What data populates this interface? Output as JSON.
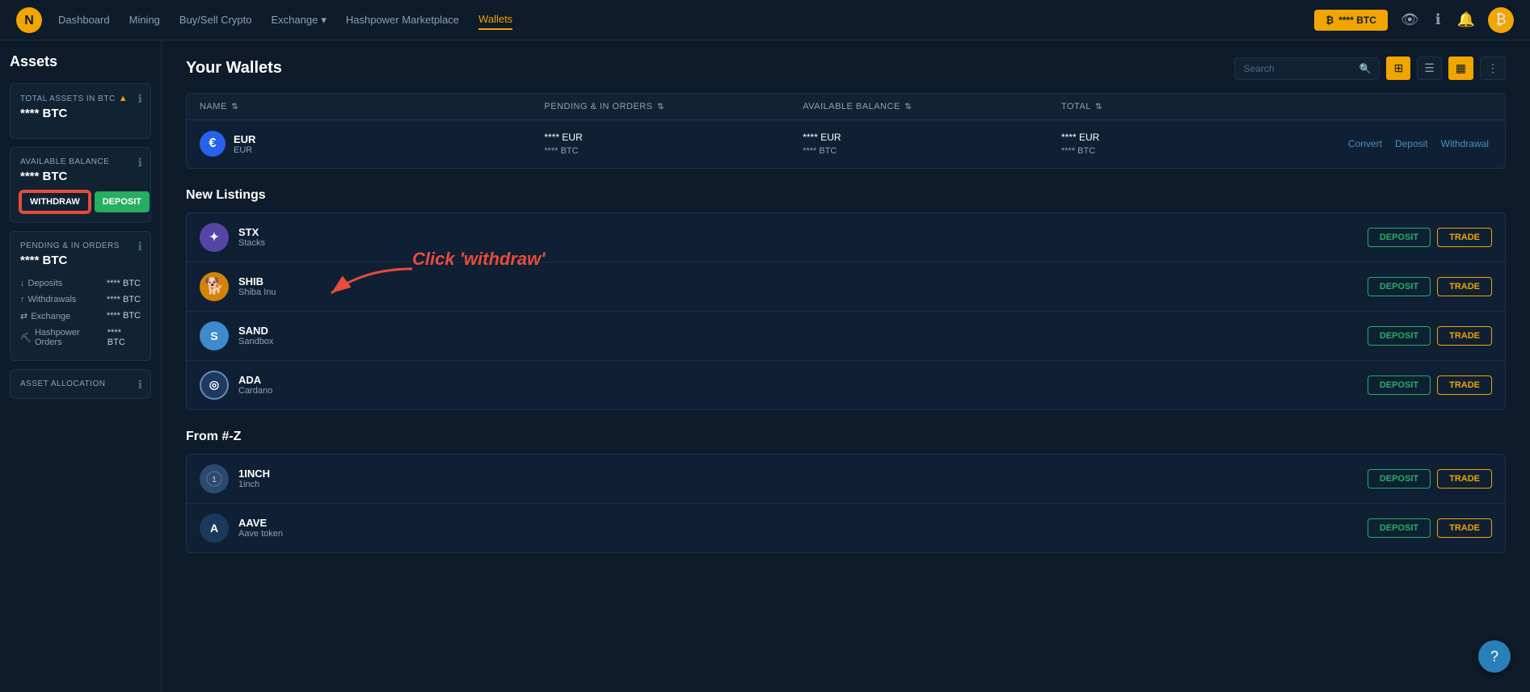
{
  "app": {
    "logo_symbol": "🟡",
    "nav_links": [
      {
        "label": "Dashboard",
        "active": false
      },
      {
        "label": "Mining",
        "active": false
      },
      {
        "label": "Buy/Sell Crypto",
        "active": false
      },
      {
        "label": "Exchange",
        "active": false,
        "has_dropdown": true
      },
      {
        "label": "Hashpower Marketplace",
        "active": false
      },
      {
        "label": "Wallets",
        "active": true
      }
    ],
    "btc_balance_btn": "**** BTC",
    "nav_icons": [
      "eye-slash",
      "info-circle",
      "bell",
      "bitcoin"
    ]
  },
  "sidebar": {
    "title": "Assets",
    "total_assets": {
      "label": "TOTAL ASSETS IN BTC",
      "value": "**** BTC"
    },
    "available_balance": {
      "label": "AVAILABLE BALANCE",
      "value": "**** BTC",
      "withdraw_label": "WITHDRAW",
      "deposit_label": "DEPOSIT"
    },
    "pending_orders": {
      "label": "PENDING & IN ORDERS",
      "value": "**** BTC",
      "rows": [
        {
          "icon": "↓",
          "label": "Deposits",
          "value": "**** BTC"
        },
        {
          "icon": "↑",
          "label": "Withdrawals",
          "value": "**** BTC"
        },
        {
          "icon": "⇄",
          "label": "Exchange",
          "value": "**** BTC"
        },
        {
          "icon": "⛏",
          "label": "Hashpower Orders",
          "value": "**** BTC"
        }
      ]
    },
    "asset_allocation": {
      "label": "ASSET ALLOCATION"
    }
  },
  "wallets": {
    "title": "Your Wallets",
    "search_placeholder": "Search",
    "table_headers": [
      {
        "label": "NAME",
        "sortable": true
      },
      {
        "label": "PENDING & IN ORDERS",
        "sortable": true
      },
      {
        "label": "AVAILABLE BALANCE",
        "sortable": true
      },
      {
        "label": "TOTAL",
        "sortable": true
      },
      {
        "label": ""
      }
    ],
    "rows": [
      {
        "icon": "€",
        "icon_bg": "#2563eb",
        "name": "EUR",
        "subtitle": "EUR",
        "pending": "**** EUR",
        "pending_sub": "**** BTC",
        "available": "**** EUR",
        "available_sub": "**** BTC",
        "total": "**** EUR",
        "total_sub": "**** BTC",
        "actions": [
          "Convert",
          "Deposit",
          "Withdrawal"
        ]
      }
    ]
  },
  "new_listings": {
    "title": "New Listings",
    "items": [
      {
        "icon": "✦",
        "icon_bg": "#5546a5",
        "name": "STX",
        "subtitle": "Stacks"
      },
      {
        "icon": "🐕",
        "icon_bg": "#d4830a",
        "name": "SHIB",
        "subtitle": "Shiba Inu"
      },
      {
        "icon": "S",
        "icon_bg": "#3d8bcd",
        "name": "SAND",
        "subtitle": "Sandbox"
      },
      {
        "icon": "◎",
        "icon_bg": "#1e3a5f",
        "name": "ADA",
        "subtitle": "Cardano"
      }
    ],
    "deposit_label": "DEPOSIT",
    "trade_label": "TRADE"
  },
  "from_az": {
    "title": "From #-Z",
    "items": [
      {
        "icon": "1",
        "icon_bg": "#2c4a6e",
        "name": "1INCH",
        "subtitle": "1inch"
      },
      {
        "icon": "A",
        "icon_bg": "#1a3a5c",
        "name": "AAVE",
        "subtitle": "Aave token"
      }
    ],
    "deposit_label": "DEPOSIT",
    "trade_label": "TRADE"
  },
  "annotation": {
    "text": "Click 'withdraw'"
  },
  "help_btn": "?"
}
